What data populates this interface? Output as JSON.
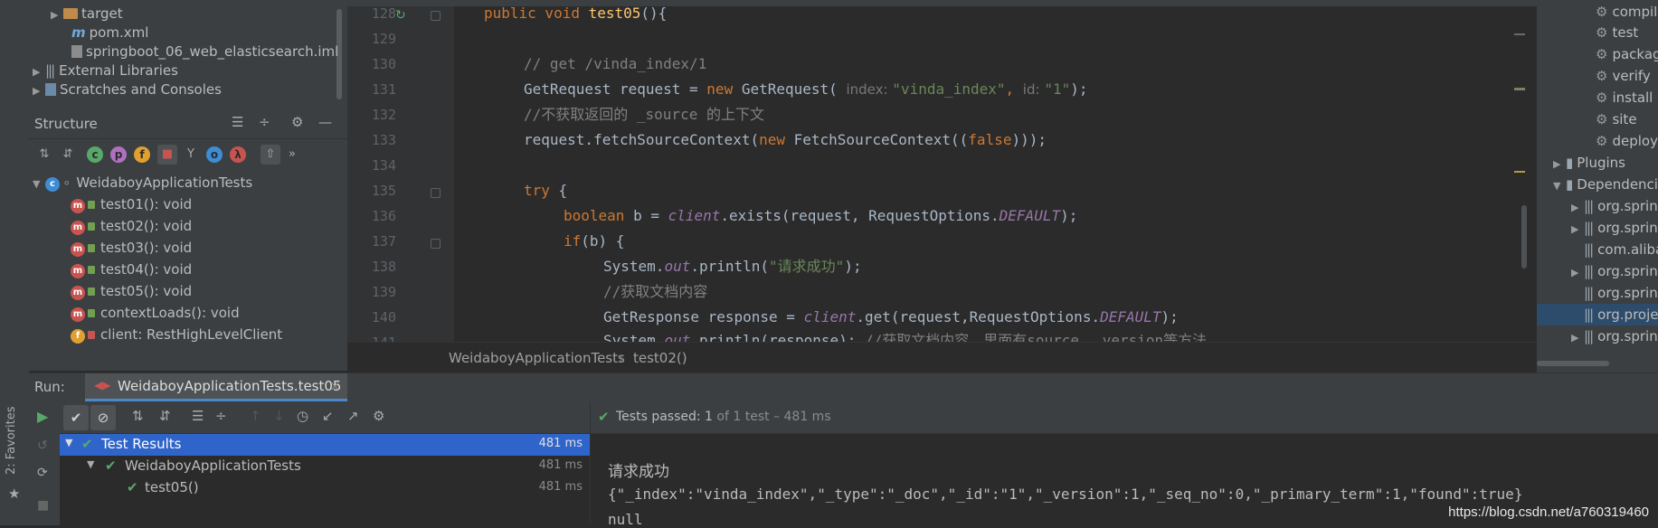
{
  "project_tree": [
    {
      "label": "target",
      "type": "folder",
      "expanded": false
    },
    {
      "label": "pom.xml",
      "type": "maven"
    },
    {
      "label": "springboot_06_web_elasticsearch.iml",
      "type": "file"
    },
    {
      "label": "External Libraries",
      "type": "library",
      "expanded": false
    },
    {
      "label": "Scratches and Consoles",
      "type": "scratch",
      "expanded": false
    }
  ],
  "structure": {
    "title": "Structure",
    "class_name": "WeidaboyApplicationTests",
    "members": [
      {
        "label": "test01(): void",
        "kind": "method"
      },
      {
        "label": "test02(): void",
        "kind": "method"
      },
      {
        "label": "test03(): void",
        "kind": "method"
      },
      {
        "label": "test04(): void",
        "kind": "method"
      },
      {
        "label": "test05(): void",
        "kind": "method"
      },
      {
        "label": "contextLoads(): void",
        "kind": "method"
      },
      {
        "label": "client: RestHighLevelClient",
        "kind": "field"
      }
    ]
  },
  "editor": {
    "line_numbers": [
      "128",
      "129",
      "130",
      "131",
      "132",
      "133",
      "134",
      "135",
      "136",
      "137",
      "138",
      "139",
      "140",
      "141"
    ],
    "code": {
      "l128_pre": "public void ",
      "l128_fn": "test05",
      "l128_post": "(){",
      "l130": "// get /vinda_index/1",
      "l131_a": "GetRequest request = ",
      "l131_new": "new",
      "l131_b": " GetRequest( ",
      "l131_h1": "index: ",
      "l131_s1": "\"vinda_index\"",
      "l131_c": ", ",
      "l131_h2": "id: ",
      "l131_s2": "\"1\"",
      "l131_d": ");",
      "l132": "//不获取返回的 _source 的上下文",
      "l133_a": "request.fetchSourceContext(",
      "l133_new": "new",
      "l133_b": " FetchSourceContext((",
      "l133_false": "false",
      "l133_c": ")));",
      "l135_try": "try",
      "l135_b": " {",
      "l136_kw": "boolean",
      "l136_a": " b = ",
      "l136_client": "client",
      "l136_b": ".exists(request, RequestOptions.",
      "l136_it": "DEFAULT",
      "l136_c": ");",
      "l137_kw": "if",
      "l137_a": "(b) {",
      "l138_a": "System.",
      "l138_out": "out",
      "l138_b": ".println(",
      "l138_s": "\"请求成功\"",
      "l138_c": ");",
      "l139": "//获取文档内容",
      "l140_a": "GetResponse response = ",
      "l140_client": "client",
      "l140_b": ".get(request,RequestOptions.",
      "l140_it": "DEFAULT",
      "l140_c": ");",
      "l141_a": "System.",
      "l141_out": "out",
      "l141_b": ".println(response); ",
      "l141_cmt": "//获取文档内容，里面有source、_version等方法"
    },
    "breadcrumb": [
      "WeidaboyApplicationTests",
      "test02()"
    ]
  },
  "maven": {
    "lifecycle": [
      "compile",
      "test",
      "package",
      "verify",
      "install",
      "site",
      "deploy"
    ],
    "plugins_label": "Plugins",
    "dependencies_label": "Dependencies",
    "dependencies": [
      "org.springframework",
      "org.springframework",
      "com.alibaba",
      "org.springframework",
      "org.springframework",
      "org.projectlombok",
      "org.springframework"
    ]
  },
  "run": {
    "label": "Run:",
    "config": "WeidaboyApplicationTests.test05",
    "side_tabs": [
      "2: Favorites"
    ],
    "status_prefix": "Tests passed: ",
    "status_count": "1",
    "status_rest": " of 1 test – 481 ms",
    "tree": [
      {
        "label": "Test Results",
        "time": "481 ms",
        "selected": true
      },
      {
        "label": "WeidaboyApplicationTests",
        "time": "481 ms"
      },
      {
        "label": "test05()",
        "time": "481 ms"
      }
    ],
    "output": [
      "请求成功",
      "{\"_index\":\"vinda_index\",\"_type\":\"_doc\",\"_id\":\"1\",\"_version\":1,\"_seq_no\":0,\"_primary_term\":1,\"found\":true}",
      "null"
    ]
  },
  "watermark": "https://blog.csdn.net/a760319460"
}
